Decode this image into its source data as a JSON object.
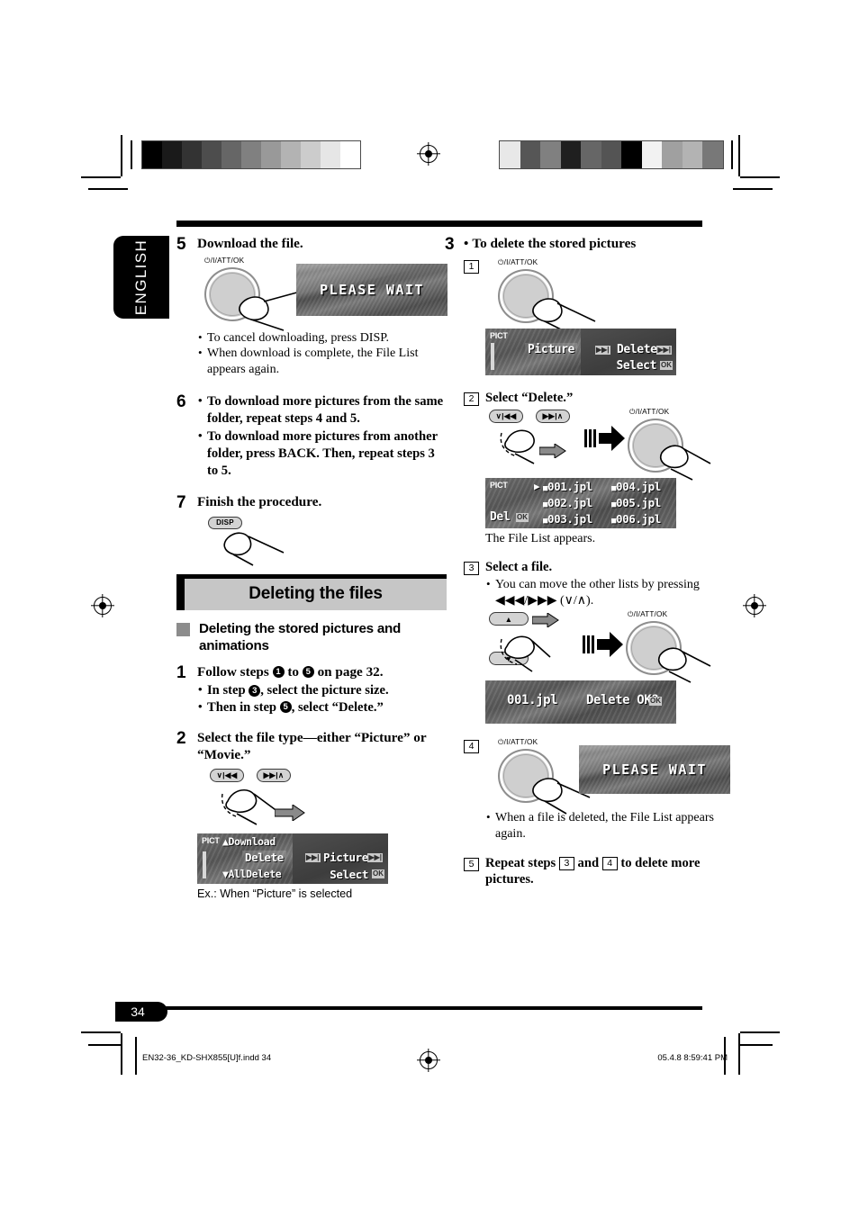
{
  "meta": {
    "language_tab": "ENGLISH",
    "page_number": "34",
    "footer_left": "EN32-36_KD-SHX855[U]f.indd   34",
    "footer_right": "05.4.8   8:59:41 PM"
  },
  "colors": {
    "ink": "#000000",
    "banner_fill": "#c6c6c6",
    "subhead_square": "#8c8c8c",
    "lcd_body": "#5a5a5a",
    "knob_face": "#c9c9c9",
    "button_face": "#d3d3d3"
  },
  "calibration": {
    "left_bar": [
      "#000000",
      "#1a1a1a",
      "#333333",
      "#4d4d4d",
      "#666666",
      "#808080",
      "#999999",
      "#b3b3b3",
      "#cccccc",
      "#e6e6e6",
      "#ffffff"
    ],
    "right_bar": [
      "#e8e8e8",
      "#565656",
      "#808080",
      "#1f1f1f",
      "#666666",
      "#545454",
      "#000000",
      "#f2f2f2",
      "#a0a0a0",
      "#b3b3b3",
      "#787878"
    ]
  },
  "left_column": {
    "step5": {
      "number": "5",
      "title": "Download the file.",
      "knob_label": "⏻/I/ATT/OK",
      "lcd_text": "PLEASE WAIT",
      "notes": [
        "To cancel downloading, press DISP.",
        "When download is complete, the File List appears again."
      ]
    },
    "step6": {
      "number": "6",
      "bullets": [
        "To download more pictures from the same folder, repeat steps 4 and 5.",
        "To download more pictures from another folder, press BACK. Then, repeat steps 3 to 5."
      ]
    },
    "step7": {
      "number": "7",
      "title": "Finish the procedure.",
      "button_label": "DISP"
    },
    "section": {
      "banner_title": "Deleting the files",
      "subhead": "Deleting the stored pictures and animations",
      "step1": {
        "number": "1",
        "title_parts": [
          "Follow steps ",
          "1",
          " to ",
          "5",
          " on page 32."
        ],
        "bullets": [
          [
            "In step ",
            "3",
            ", select the picture size."
          ],
          [
            "Then in step ",
            "5",
            ", select “Delete.”"
          ]
        ]
      },
      "step2": {
        "number": "2",
        "title": "Select the file type—either “Picture” or “Movie.”",
        "button_left": "∨|◀◀",
        "button_right": "▶▶|∧",
        "lcd": {
          "pict_label": "PICT",
          "menu_items": [
            "Download",
            "Delete",
            "AllDelete"
          ],
          "selected_item": "Delete",
          "right_value": "Picture",
          "right_action": "Select",
          "ok_badge": "OK",
          "skip_badge": "▶▶|"
        },
        "caption": "Ex.: When “Picture” is selected"
      }
    }
  },
  "right_column": {
    "step3": {
      "number": "3",
      "title": "To delete the stored pictures",
      "sub1": {
        "number": "1",
        "knob_label": "⏻/I/ATT/OK",
        "lcd": {
          "pict_label": "PICT",
          "left_value": "Picture",
          "right_value": "Delete",
          "right_action": "Select",
          "ok_badge": "OK"
        }
      },
      "sub2": {
        "number": "2",
        "title": "Select “Delete.”",
        "button_left": "∨|◀◀",
        "button_right": "▶▶|∧",
        "knob_label": "⏻/I/ATT/OK",
        "lcd": {
          "pict_label": "PICT",
          "mode_label": "Del",
          "ok_badge": "OK",
          "files_col1": [
            "001.jpl",
            "002.jpl",
            "003.jpl"
          ],
          "files_col2": [
            "004.jpl",
            "005.jpl",
            "006.jpl"
          ],
          "cursor_on": "001.jpl"
        },
        "caption": "The File List appears."
      },
      "sub3": {
        "number": "3",
        "title": "Select a file.",
        "note": "You can move the other lists by pressing ◀◀◀/▶▶▶ (∨/∧).",
        "knob_label": "⏻/I/ATT/OK",
        "lcd": {
          "file_name": "001.jpl",
          "prompt": "Delete OK?",
          "ok_badge": "OK"
        }
      },
      "sub4": {
        "number": "4",
        "knob_label": "⏻/I/ATT/OK",
        "lcd_text": "PLEASE WAIT",
        "note": "When a file is deleted, the File List appears again."
      },
      "sub5": {
        "number": "5",
        "title_parts": [
          "Repeat steps ",
          "3",
          " and ",
          "4",
          " to delete more pictures."
        ]
      }
    }
  }
}
